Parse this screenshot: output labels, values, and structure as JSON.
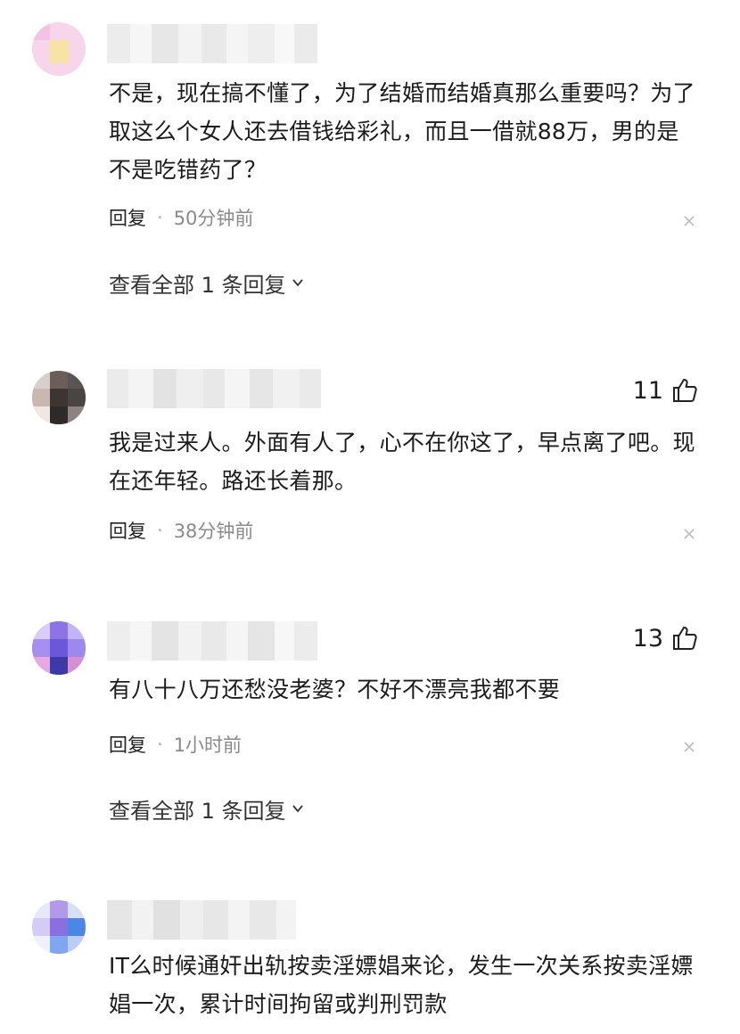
{
  "comments": [
    {
      "text": "不是，现在搞不懂了，为了结婚而结婚真那么重要吗？为了取这么个女人还去借钱给彩礼，而且一借就88万，男的是不是吃错药了？",
      "reply_label": "回复",
      "separator": "·",
      "time": "50分钟前",
      "close_icon": "close-icon",
      "expand": "查看全部 1 条回复",
      "likes": ""
    },
    {
      "text": "我是过来人。外面有人了，心不在你这了，早点离了吧。现在还年轻。路还长着那。",
      "reply_label": "回复",
      "separator": "·",
      "time": "38分钟前",
      "close_icon": "close-icon",
      "expand": "",
      "likes": "11"
    },
    {
      "text": "有八十八万还愁没老婆？不好不漂亮我都不要",
      "reply_label": "回复",
      "separator": "·",
      "time": "1小时前",
      "close_icon": "close-icon",
      "expand": "查看全部 1 条回复",
      "likes": "13"
    },
    {
      "text": "IT么时候通奸出轨按卖淫嫖娼来论，发生一次关系按卖淫嫖娼一次，累计时间拘留或判刑罚款",
      "reply_label": "",
      "separator": "",
      "time": "",
      "close_icon": "",
      "expand": "",
      "likes": ""
    }
  ],
  "colors": {
    "blur_light": "#f1f1f1",
    "blur_mid": "#e2e2e2",
    "icon_gray": "#bdbdbd"
  }
}
